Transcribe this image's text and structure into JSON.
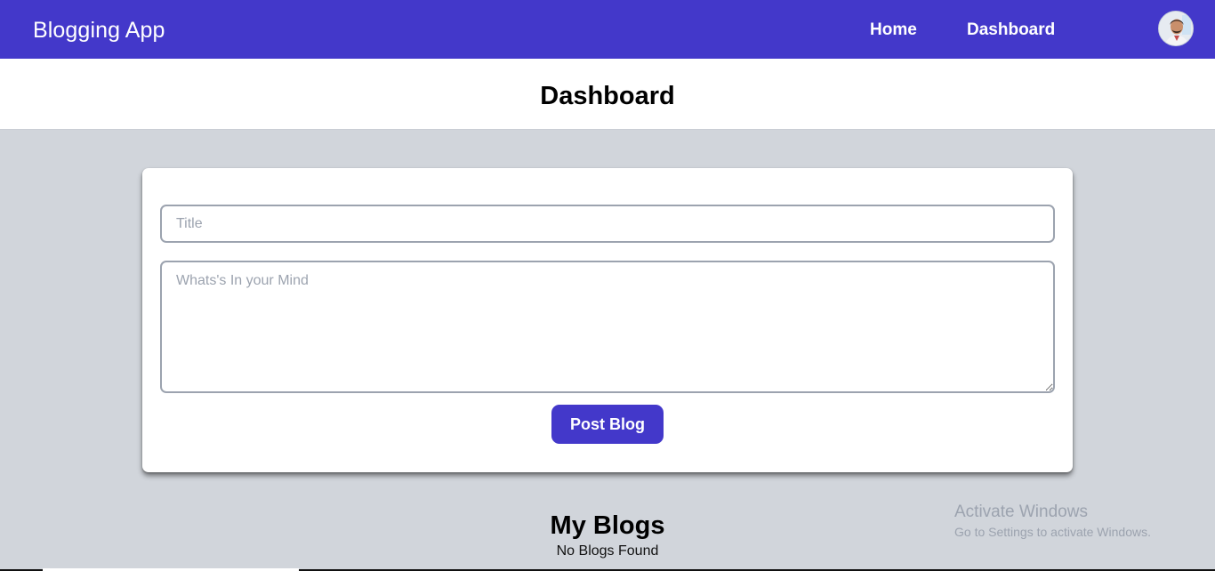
{
  "navbar": {
    "brand": "Blogging App",
    "links": [
      {
        "label": "Home"
      },
      {
        "label": "Dashboard"
      }
    ],
    "accent_color": "#4338ca"
  },
  "page": {
    "title": "Dashboard"
  },
  "form": {
    "title_placeholder": "Title",
    "title_value": "",
    "content_placeholder": "Whats's In your Mind",
    "content_value": "",
    "submit_label": "Post Blog"
  },
  "blogs": {
    "heading": "My Blogs",
    "empty_message": "No Blogs Found"
  },
  "os_overlay": {
    "title": "Activate Windows",
    "subtitle": "Go to Settings to activate Windows."
  }
}
